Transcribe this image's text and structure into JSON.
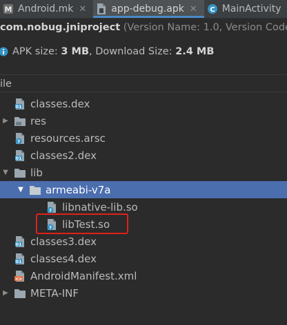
{
  "tabs": [
    {
      "label": "Android.mk",
      "icon": "makefile-icon",
      "closable": true,
      "active": false
    },
    {
      "label": "app-debug.apk",
      "icon": "apk-file-icon",
      "closable": true,
      "active": true
    },
    {
      "label": "MainActivity",
      "icon": "class-icon",
      "closable": false,
      "active": false
    }
  ],
  "header": {
    "package_name": "com.nobug.jniproject",
    "version_prefix": " (Version Name: ",
    "version_name": "1.0",
    "version_suffix": ", Version Code: "
  },
  "size_info": {
    "apk_label": "APK size: ",
    "apk_size": "3 MB",
    "download_label": ", Download Size: ",
    "download_size": "2.4 MB"
  },
  "column_header": "ile",
  "tree": [
    {
      "label": "classes.dex",
      "icon": "dex-file-icon",
      "depth": 0,
      "expandable": false
    },
    {
      "label": "res",
      "icon": "folder-icon",
      "depth": 0,
      "expandable": true,
      "expanded": false
    },
    {
      "label": "resources.arsc",
      "icon": "unknown-file-icon",
      "depth": 0,
      "expandable": false
    },
    {
      "label": "classes2.dex",
      "icon": "dex-file-icon",
      "depth": 0,
      "expandable": false
    },
    {
      "label": "lib",
      "icon": "folder-icon",
      "depth": 0,
      "expandable": true,
      "expanded": true
    },
    {
      "label": "armeabi-v7a",
      "icon": "folder-icon",
      "depth": 1,
      "expandable": true,
      "expanded": true,
      "selected": true
    },
    {
      "label": "libnative-lib.so",
      "icon": "unknown-file-icon",
      "depth": 2,
      "expandable": false
    },
    {
      "label": "libTest.so",
      "icon": "unknown-file-icon",
      "depth": 2,
      "expandable": false,
      "highlighted": true
    },
    {
      "label": "classes3.dex",
      "icon": "dex-file-icon",
      "depth": 0,
      "expandable": false
    },
    {
      "label": "classes4.dex",
      "icon": "dex-file-icon",
      "depth": 0,
      "expandable": false
    },
    {
      "label": "AndroidManifest.xml",
      "icon": "xml-file-icon",
      "depth": 0,
      "expandable": false
    },
    {
      "label": "META-INF",
      "icon": "folder-icon",
      "depth": 0,
      "expandable": true,
      "expanded": false
    }
  ],
  "colors": {
    "background": "#2b2b2b",
    "selection": "#4b6eaf",
    "highlight_border": "#e0211b",
    "info_blue": "#3592c4"
  }
}
